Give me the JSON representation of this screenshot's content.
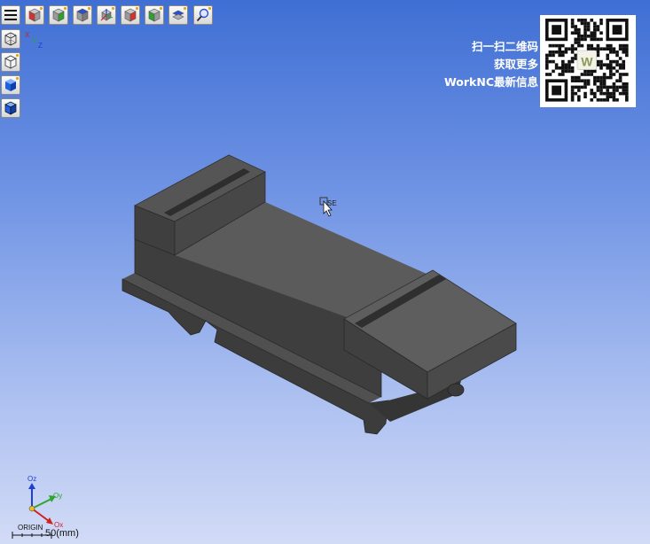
{
  "toolbar": {
    "items": [
      {
        "name": "menu-button",
        "icon": "hamburger-menu-icon"
      },
      {
        "name": "view-front-button",
        "icon": "cube-red-face-icon"
      },
      {
        "name": "view-left-button",
        "icon": "cube-green-face-icon"
      },
      {
        "name": "view-top-button",
        "icon": "cube-blue-face-icon"
      },
      {
        "name": "view-iso-button",
        "icon": "cube-axes-icon"
      },
      {
        "name": "view-right-button",
        "icon": "cube-red-side-icon"
      },
      {
        "name": "view-back-button",
        "icon": "cube-green-side-icon"
      },
      {
        "name": "view-bottom-button",
        "icon": "cube-plane-icon"
      },
      {
        "name": "zoom-fit-button",
        "icon": "magnifier-icon"
      }
    ]
  },
  "side_toolbar": {
    "items": [
      {
        "name": "wireframe-view-button",
        "icon": "wireframe-cube-icon"
      },
      {
        "name": "axis-xyz-button",
        "icon": "xyz-axis-icon",
        "labels": [
          "X",
          "Y",
          "Z"
        ]
      },
      {
        "name": "hidden-line-view-button",
        "icon": "outline-cube-icon"
      },
      {
        "name": "shaded-view-button",
        "icon": "shaded-cube-icon"
      },
      {
        "name": "shaded-edges-view-button",
        "icon": "shaded-edges-cube-icon"
      }
    ]
  },
  "promo": {
    "line1": "扫一扫二维码",
    "line2": "获取更多",
    "line3": "WorkNC最新信息",
    "qr_logo": "W"
  },
  "cursor_tag": "SE",
  "triad": {
    "z_label": "Oz",
    "y_label": "Oy",
    "x_label": "Ox",
    "origin_label": "ORIGIN",
    "scale_label": "50(mm)"
  },
  "colors": {
    "background_top": "#3f6fd4",
    "background_bottom": "#d2dbf6",
    "model_top": "#5a5a5a",
    "model_side": "#3a3a3a",
    "z_axis": "#1f3fd0",
    "y_axis": "#2fa52f",
    "x_axis": "#d02020"
  }
}
